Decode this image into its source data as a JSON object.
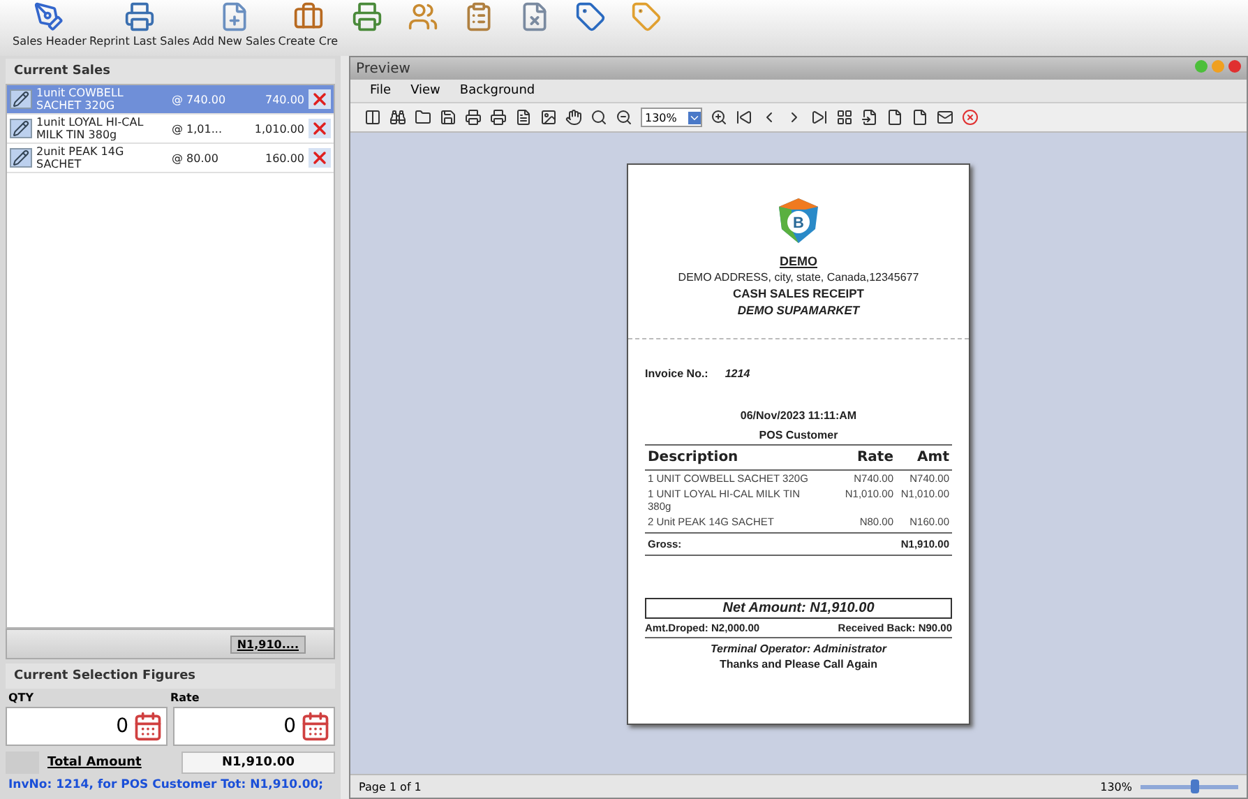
{
  "toolbar": {
    "buttons": [
      {
        "label": "Sales Header",
        "kind": "font"
      },
      {
        "label": "Reprint Last Sales",
        "kind": "printer"
      },
      {
        "label": "Add New Sales",
        "kind": "newdoc"
      },
      {
        "label": "Create Cre",
        "kind": "briefcase"
      },
      {
        "kind": "printer2"
      },
      {
        "kind": "people"
      },
      {
        "kind": "clipboard"
      },
      {
        "kind": "docx"
      },
      {
        "kind": "tag"
      },
      {
        "kind": "tag2"
      }
    ]
  },
  "current_sales": {
    "title": "Current Sales",
    "rows": [
      {
        "item": "1unit COWBELL SACHET 320G",
        "rate": "@ 740.00",
        "amount": "740.00",
        "selected": true
      },
      {
        "item": "1unit LOYAL HI-CAL MILK TIN 380g",
        "rate": "@ 1,01...",
        "amount": "1,010.00",
        "selected": false
      },
      {
        "item": "2unit PEAK 14G SACHET",
        "rate": "@ 80.00",
        "amount": "160.00",
        "selected": false
      }
    ],
    "total": "N1,910...."
  },
  "selection": {
    "title": "Current Selection Figures",
    "qty_label": "QTY",
    "rate_label": "Rate",
    "qty": "0",
    "rate": "0",
    "total_label": "Total Amount",
    "total": "N1,910.00",
    "status": "InvNo: 1214, for POS Customer Tot: N1,910.00;"
  },
  "preview": {
    "title": "Preview",
    "menu": [
      "File",
      "View",
      "Background"
    ],
    "zoom": "130%",
    "page_status": "Page 1 of 1",
    "zoom_status": "130%",
    "zoom_slider": {
      "level": 0.55
    },
    "receipt": {
      "logo_letter": "B",
      "company": "DEMO",
      "address": "DEMO ADDRESS, city, state, Canada,12345677",
      "heading": "CASH SALES RECEIPT",
      "shop": "DEMO SUPAMARKET",
      "invoice_label": "Invoice No.:",
      "invoice": "1214",
      "datetime": "06/Nov/2023 11:11:AM",
      "customer": "POS Customer",
      "columns": [
        "Description",
        "Rate",
        "Amt"
      ],
      "lines": [
        [
          "1 UNIT COWBELL SACHET 320G",
          "N740.00",
          "N740.00"
        ],
        [
          "1 UNIT LOYAL HI-CAL MILK TIN 380g",
          "N1,010.00",
          "N1,010.00"
        ],
        [
          "2 Unit PEAK 14G SACHET",
          "N80.00",
          "N160.00"
        ]
      ],
      "gross_label": "Gross:",
      "gross": "N1,910.00",
      "net": "Net Amount: N1,910.00",
      "dropped": "Amt.Droped: N2,000.00",
      "received": "Received Back: N90.00",
      "operator": "Terminal Operator: Administrator",
      "thanks": "Thanks and Please Call Again"
    }
  }
}
